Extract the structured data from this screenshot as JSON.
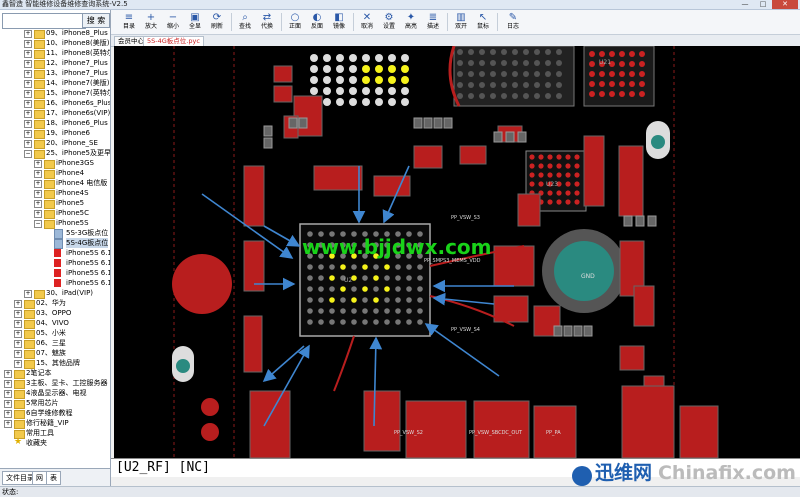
{
  "window": {
    "title": "鑫智造 智能维修设备维修查询系统-V2.5",
    "minimize": "—",
    "maximize": "□",
    "close": "✕"
  },
  "search": {
    "value": "",
    "button": "搜 索"
  },
  "tree": [
    {
      "indent": 2,
      "exp": "+",
      "icon": "folder",
      "label": "09、iPhone8_Plus"
    },
    {
      "indent": 2,
      "exp": "+",
      "icon": "folder",
      "label": "10、iPhone8(美版)"
    },
    {
      "indent": 2,
      "exp": "+",
      "icon": "folder",
      "label": "11、iPhone8(英特尔)"
    },
    {
      "indent": 2,
      "exp": "+",
      "icon": "folder",
      "label": "12、iPhone7_Plus"
    },
    {
      "indent": 2,
      "exp": "+",
      "icon": "folder",
      "label": "13、iPhone7_Plus"
    },
    {
      "indent": 2,
      "exp": "+",
      "icon": "folder",
      "label": "14、iPhone7(美版)"
    },
    {
      "indent": 2,
      "exp": "+",
      "icon": "folder",
      "label": "15、iPhone7(英特尔)"
    },
    {
      "indent": 2,
      "exp": "+",
      "icon": "folder",
      "label": "16、iPhone6s_Plus"
    },
    {
      "indent": 2,
      "exp": "+",
      "icon": "folder",
      "label": "17、iPhone6s(VIP)"
    },
    {
      "indent": 2,
      "exp": "+",
      "icon": "folder",
      "label": "18、iPhone6_Plus"
    },
    {
      "indent": 2,
      "exp": "+",
      "icon": "folder",
      "label": "19、iPhone6"
    },
    {
      "indent": 2,
      "exp": "+",
      "icon": "folder",
      "label": "20、iPhone_SE"
    },
    {
      "indent": 2,
      "exp": "−",
      "icon": "folder",
      "label": "25、iPhone5及更早"
    },
    {
      "indent": 3,
      "exp": "+",
      "icon": "folder",
      "label": "iPhone3GS"
    },
    {
      "indent": 3,
      "exp": "+",
      "icon": "folder",
      "label": "iPhone4"
    },
    {
      "indent": 3,
      "exp": "+",
      "icon": "folder",
      "label": "iPhone4 电信版"
    },
    {
      "indent": 3,
      "exp": "+",
      "icon": "folder",
      "label": "iPhone4S"
    },
    {
      "indent": 3,
      "exp": "+",
      "icon": "folder",
      "label": "iPhone5"
    },
    {
      "indent": 3,
      "exp": "+",
      "icon": "folder",
      "label": "iPhone5C"
    },
    {
      "indent": 3,
      "exp": "−",
      "icon": "folder",
      "label": "iPhone5S"
    },
    {
      "indent": 4,
      "exp": "",
      "icon": "doc",
      "label": "5S-3G板点位"
    },
    {
      "indent": 4,
      "exp": "",
      "icon": "doc",
      "label": "5S-4G板点位",
      "selected": true
    },
    {
      "indent": 4,
      "exp": "",
      "icon": "pdf",
      "label": "iPhone5S 6.1"
    },
    {
      "indent": 4,
      "exp": "",
      "icon": "pdf",
      "label": "iPhone5S 6.1"
    },
    {
      "indent": 4,
      "exp": "",
      "icon": "pdf",
      "label": "iPhone5S 6.1"
    },
    {
      "indent": 4,
      "exp": "",
      "icon": "pdf",
      "label": "iPhone5S 6.1"
    },
    {
      "indent": 2,
      "exp": "+",
      "icon": "folder",
      "label": "30、iPad(VIP)"
    },
    {
      "indent": 1,
      "exp": "+",
      "icon": "folder",
      "label": "02、华为"
    },
    {
      "indent": 1,
      "exp": "+",
      "icon": "folder",
      "label": "03、OPPO"
    },
    {
      "indent": 1,
      "exp": "+",
      "icon": "folder",
      "label": "04、VIVO"
    },
    {
      "indent": 1,
      "exp": "+",
      "icon": "folder",
      "label": "05、小米"
    },
    {
      "indent": 1,
      "exp": "+",
      "icon": "folder",
      "label": "06、三星"
    },
    {
      "indent": 1,
      "exp": "+",
      "icon": "folder",
      "label": "07、魅族"
    },
    {
      "indent": 1,
      "exp": "+",
      "icon": "folder",
      "label": "15、其他品牌"
    },
    {
      "indent": 0,
      "exp": "+",
      "icon": "folder",
      "label": "2笔记本"
    },
    {
      "indent": 0,
      "exp": "+",
      "icon": "folder",
      "label": "3主板、显卡、工控服务器"
    },
    {
      "indent": 0,
      "exp": "+",
      "icon": "folder",
      "label": "4液晶显示器、电视"
    },
    {
      "indent": 0,
      "exp": "+",
      "icon": "folder",
      "label": "5常用芯片"
    },
    {
      "indent": 0,
      "exp": "+",
      "icon": "folder",
      "label": "6自学维修教程"
    },
    {
      "indent": 0,
      "exp": "+",
      "icon": "folder",
      "label": "修行秘籍_VIP"
    },
    {
      "indent": 0,
      "exp": "",
      "icon": "folder",
      "label": "常用工具"
    },
    {
      "indent": 0,
      "exp": "",
      "icon": "star",
      "label": "收藏夹"
    }
  ],
  "left_tabs": [
    "文件目录",
    "网",
    "表"
  ],
  "toolbar": [
    {
      "label": "目录",
      "icon": "≡"
    },
    {
      "label": "放大",
      "icon": "+"
    },
    {
      "label": "缩小",
      "icon": "−"
    },
    {
      "label": "全显",
      "icon": "▣"
    },
    {
      "label": "刷新",
      "icon": "⟳"
    },
    {
      "label": "查找",
      "icon": "⌕"
    },
    {
      "label": "代换",
      "icon": "⇄"
    },
    {
      "label": "正面",
      "icon": "○"
    },
    {
      "label": "反面",
      "icon": "◐"
    },
    {
      "label": "镜像",
      "icon": "◧"
    },
    {
      "label": "取消",
      "icon": "✕"
    },
    {
      "label": "设置",
      "icon": "⚙"
    },
    {
      "label": "高亮",
      "icon": "✦"
    },
    {
      "label": "描述",
      "icon": "≣"
    },
    {
      "label": "双开",
      "icon": "▥"
    },
    {
      "label": "鼠标",
      "icon": "↖"
    },
    {
      "label": "日志",
      "icon": "✎"
    }
  ],
  "doc_tabs": [
    {
      "label": "会员中心",
      "active": false
    },
    {
      "label": "5S-4G板点位.pyc",
      "active": true
    }
  ],
  "board": {
    "watermark": "www.bjjdwx.com",
    "labels": [
      "U2",
      "U21",
      "U23",
      "PP_VSW_S3",
      "PP_SMPS3_MEMS_VDD",
      "PP_VSW_S4",
      "PP_VSW_S2",
      "PP_VSW_SBCDC_OUT",
      "PP_PA",
      "GND"
    ]
  },
  "status_text": "[U2_RF] [NC]",
  "bottom": {
    "label": "状态:"
  },
  "brand": {
    "cn": "迅维网",
    "en": "Chinafix.com"
  }
}
